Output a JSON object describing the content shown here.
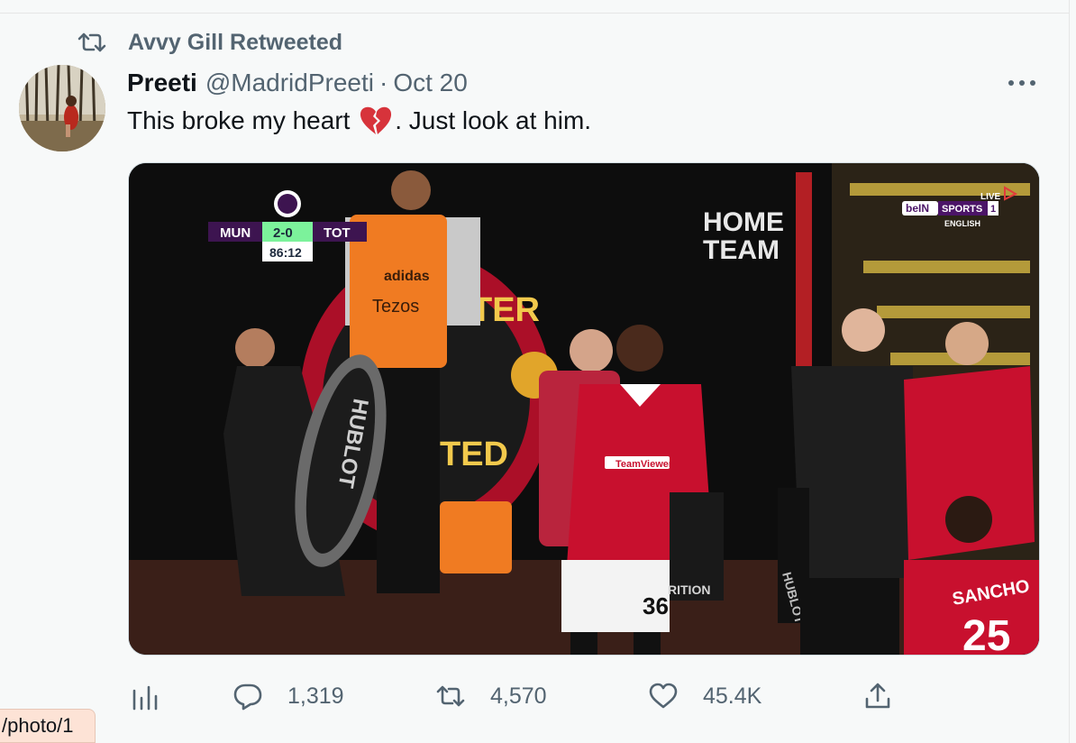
{
  "retweet_context": {
    "icon": "retweet-icon",
    "label": "Avvy Gill Retweeted"
  },
  "tweet": {
    "author_name": "Preeti",
    "author_handle": "@MadridPreeti",
    "separator": "·",
    "date": "Oct 20",
    "text_before_emoji": "This broke my heart ",
    "emoji": "broken-heart-emoji",
    "text_after_emoji": ". Just look at him.",
    "more_icon": "more-icon"
  },
  "media": {
    "scoreboard": {
      "home": "MUN",
      "score": "2-0",
      "away": "TOT",
      "clock": "86:12"
    },
    "broadcast": {
      "live": "LIVE",
      "brand": "beIN",
      "channel": "SPORTS",
      "channel_number": "1",
      "language": "ENGLISH"
    },
    "signage": {
      "home_team_line1": "HOME",
      "home_team_line2": "TEAM",
      "bib_brand": "adidas",
      "bib_sponsor": "Tezos",
      "shirt_sponsor": "TeamViewer",
      "player_number": "36",
      "sancho_name": "SANCHO",
      "sancho_number": "25",
      "crest_top": "TER",
      "crest_bottom": "TED",
      "board_text": "HUBLOT",
      "bench_text": "RITION"
    }
  },
  "actions": {
    "analytics_icon": "analytics-icon",
    "reply_icon": "reply-icon",
    "reply_count": "1,319",
    "retweet_icon": "retweet-icon",
    "retweet_count": "4,570",
    "like_icon": "like-icon",
    "like_count": "45.4K",
    "share_icon": "share-icon"
  },
  "status_tooltip": "/photo/1",
  "colors": {
    "secondary_text": "#536471",
    "primary_text": "#0f1419",
    "background": "#f7f9f9",
    "man_utd_red": "#c8102e",
    "score_green": "#7cf29b",
    "bib_orange": "#f07b22"
  }
}
